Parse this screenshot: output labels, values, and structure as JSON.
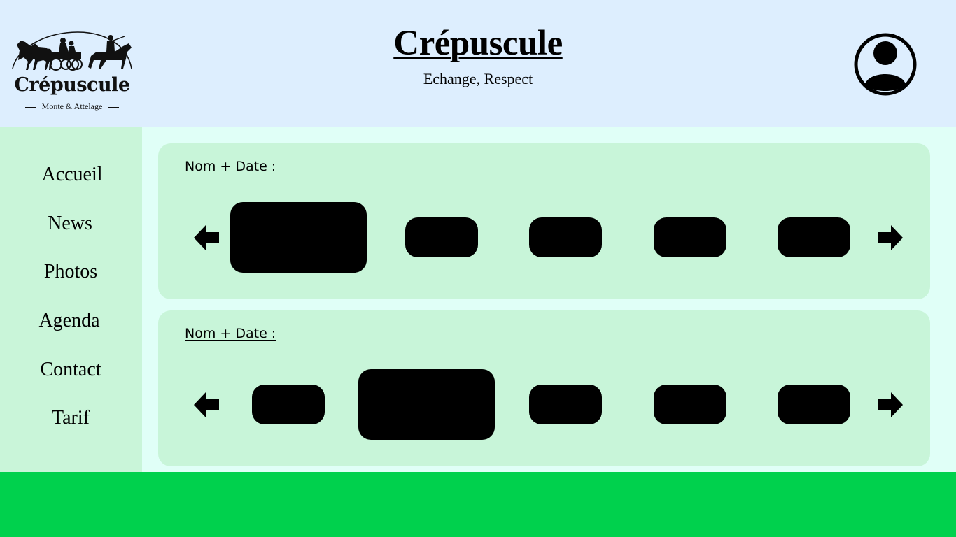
{
  "header": {
    "logo": {
      "name": "Crépuscule",
      "tagline": "Monte & Attelage"
    },
    "title": "Crépuscule",
    "subtitle": "Echange, Respect"
  },
  "nav": {
    "items": [
      {
        "label": "Accueil"
      },
      {
        "label": "News"
      },
      {
        "label": "Photos"
      },
      {
        "label": "Agenda"
      },
      {
        "label": "Contact"
      },
      {
        "label": "Tarif"
      }
    ]
  },
  "galleries": [
    {
      "label": "Nom + Date :"
    },
    {
      "label": "Nom + Date :"
    }
  ],
  "icons": {
    "avatar": "user-avatar-icon",
    "prev": "arrow-left-icon",
    "next": "arrow-right-icon"
  },
  "colors": {
    "header_bg": "#ddeefe",
    "sidebar_bg": "#c9f5d9",
    "card_bg": "#c8f5d9",
    "page_bg": "#e0fff7",
    "footer_bg": "#00d14d"
  }
}
